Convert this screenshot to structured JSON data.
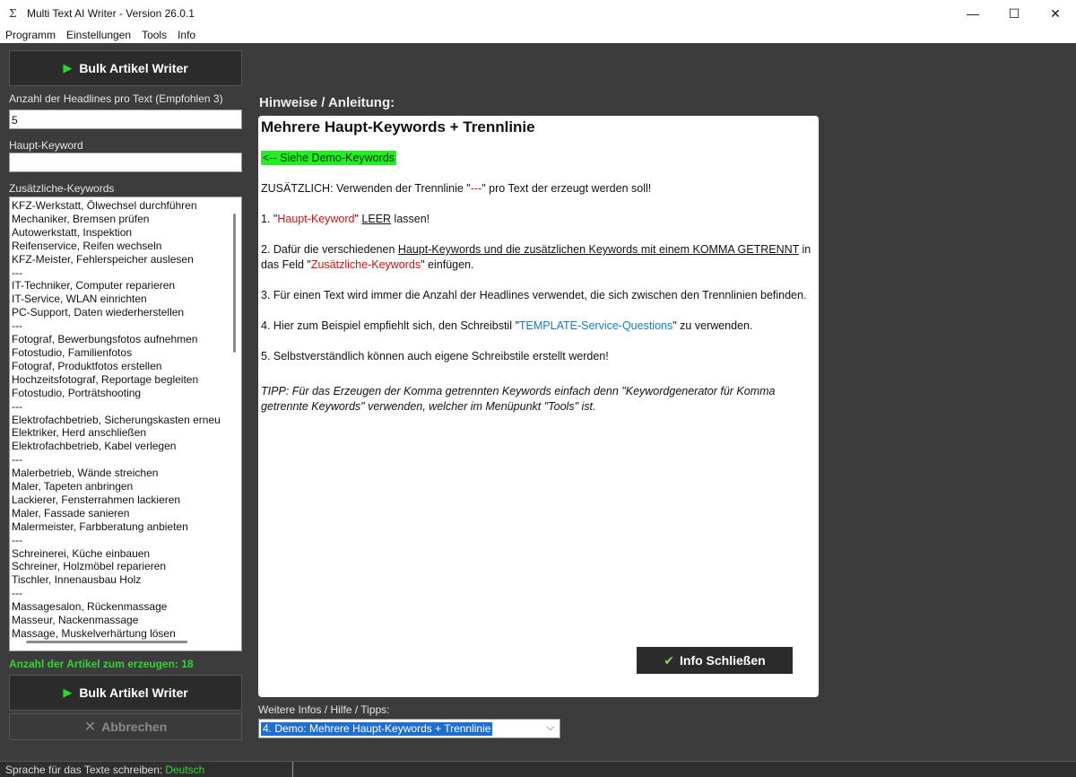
{
  "window": {
    "icon_glyph": "Σ",
    "title": "Multi Text AI Writer - Version 26.0.1",
    "minimize": "—",
    "maximize": "☐",
    "close": "✕"
  },
  "menu": [
    "Programm",
    "Einstellungen",
    "Tools",
    "Info"
  ],
  "left": {
    "top_button": "Bulk Artikel Writer",
    "headlines_label": "Anzahl der Headlines pro Text (Empfohlen 3)",
    "headlines_value": "5",
    "haupt_label": "Haupt-Keyword",
    "haupt_value": "",
    "zusatz_label": "Zusätzliche-Keywords",
    "keywords": [
      "KFZ-Werkstatt, Ölwechsel durchführen",
      "Mechaniker, Bremsen prüfen",
      "Autowerkstatt, Inspektion",
      "Reifenservice, Reifen wechseln",
      "KFZ-Meister, Fehlerspeicher auslesen",
      "---",
      "IT-Techniker, Computer reparieren",
      "IT-Service, WLAN einrichten",
      "PC-Support, Daten wiederherstellen",
      "---",
      "Fotograf, Bewerbungsfotos aufnehmen",
      "Fotostudio, Familienfotos",
      "Fotograf, Produktfotos erstellen",
      "Hochzeitsfotograf, Reportage begleiten",
      "Fotostudio, Porträtshooting",
      "---",
      "Elektrofachbetrieb, Sicherungskasten erneu",
      "Elektriker, Herd anschließen",
      "Elektrofachbetrieb, Kabel verlegen",
      "---",
      "Malerbetrieb, Wände streichen",
      "Maler, Tapeten anbringen",
      "Lackierer, Fensterrahmen lackieren",
      "Maler, Fassade sanieren",
      "Malermeister, Farbberatung anbieten",
      "---",
      "Schreinerei, Küche einbauen",
      "Schreiner, Holzmöbel reparieren",
      "Tischler, Innenausbau Holz",
      "---",
      "Massagesalon, Rückenmassage",
      "Masseur, Nackenmassage",
      "Massage, Muskelverhärtung lösen"
    ],
    "count_label": "Anzahl der Artikel zum erzeugen: 18",
    "bottom_button": "Bulk Artikel Writer",
    "cancel_button": "Abbrechen"
  },
  "info": {
    "section_title": "Hinweise / Anleitung:",
    "heading": "Mehrere Haupt-Keywords + Trennlinie",
    "demo_link": "<-- Siehe Demo-Keywords",
    "p0_a": "ZUSÄTZLICH: Verwenden der Trennlinie \"",
    "p0_b": "---",
    "p0_c": "\" pro Text der erzeugt werden soll!",
    "p1_a": "1. \"",
    "p1_b": "Haupt-Keyword",
    "p1_c": "\" ",
    "p1_d": "LEER",
    "p1_e": " lassen!",
    "p2_a": "2. Dafür die verschiedenen ",
    "p2_b": "Haupt-Keywords und die zusätzlichen Keywords mit einem KOMMA GETRENNT",
    "p2_c": " in das Feld \"",
    "p2_d": "Zusätzliche-Keywords",
    "p2_e": "\" einfügen.",
    "p3": "3. Für einen Text wird immer die Anzahl der Headlines verwendet, die sich zwischen den Trennlinien befinden.",
    "p4_a": "4. Hier zum Beispiel empfiehlt sich, den Schreibstil \"",
    "p4_b": "TEMPLATE-Service-Questions",
    "p4_c": "\" zu verwenden.",
    "p5": "5. Selbstverständlich können auch eigene Schreibstile erstellt werden!",
    "tip": "TIPP: Für das Erzeugen der Komma getrennten Keywords einfach denn \"Keywordgenerator für Komma getrennte Keywords\" verwenden, welcher im Menüpunkt \"Tools\" ist.",
    "close_button": "Info Schließen",
    "more_label": "Weitere Infos / Hilfe / Tipps:",
    "select_value": "4. Demo: Mehrere Haupt-Keywords + Trennlinie"
  },
  "status": {
    "label": "Sprache für das Texte schreiben:",
    "language": "Deutsch"
  },
  "colors": {
    "accent_green": "#22ee22",
    "count_green": "#2fd62f",
    "red_text": "#cc1111",
    "blue_text": "#1a7abf",
    "dark_button": "#2b2b2b",
    "background": "#3c3c3c"
  }
}
